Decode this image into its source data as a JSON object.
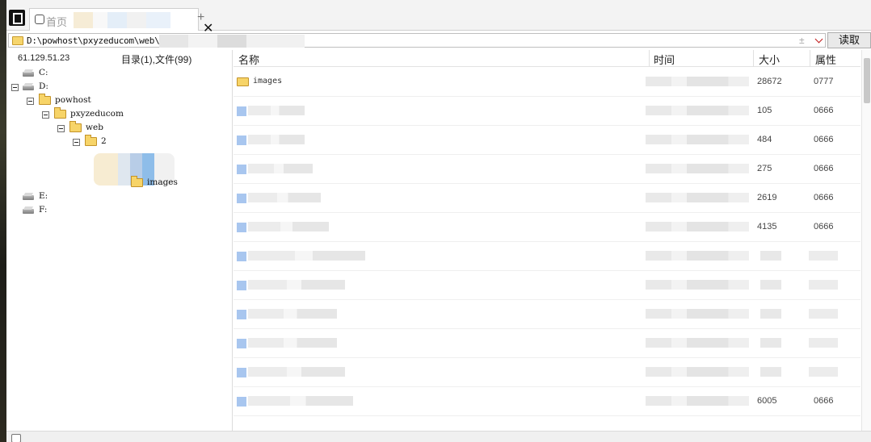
{
  "tabbar": {
    "tab_label": "首页",
    "close_glyph": "✕",
    "new_tab_glyph": "+"
  },
  "pathbar": {
    "path_text": "D:\\powhost\\pxyzeducom\\web\\2",
    "extra_glyph": "±",
    "read_button": "读取"
  },
  "leftpane": {
    "ip": "61.129.51.23",
    "dir_count": "目录(1),文件(99)",
    "tree": [
      {
        "label": "C:",
        "type": "drive",
        "expanded": false
      },
      {
        "label": "D:",
        "type": "drive",
        "expanded": true
      },
      {
        "label": "powhost",
        "type": "folder",
        "expanded": true
      },
      {
        "label": "pxyzeducom",
        "type": "folder",
        "expanded": true
      },
      {
        "label": "web",
        "type": "folder",
        "expanded": true
      },
      {
        "label": "2",
        "type": "folder",
        "expanded": true
      },
      {
        "label": "images",
        "type": "folder",
        "expanded": false
      },
      {
        "label": "E:",
        "type": "drive",
        "expanded": false
      },
      {
        "label": "F:",
        "type": "drive",
        "expanded": false
      }
    ]
  },
  "rightpane": {
    "columns": {
      "name": "名称",
      "time": "时间",
      "size": "大小",
      "attr": "属性"
    },
    "rows": [
      {
        "name": "images",
        "type": "folder",
        "size": "28672",
        "attr": "0777"
      },
      {
        "name": "",
        "type": "file",
        "size": "105",
        "attr": "0666"
      },
      {
        "name": "",
        "type": "file",
        "size": "484",
        "attr": "0666"
      },
      {
        "name": "",
        "type": "file",
        "size": "275",
        "attr": "0666"
      },
      {
        "name": "",
        "type": "file",
        "size": "2619",
        "attr": "0666"
      },
      {
        "name": "",
        "type": "file",
        "size": "4135",
        "attr": "0666"
      },
      {
        "name": "",
        "type": "file",
        "size": "",
        "attr": ""
      },
      {
        "name": "",
        "type": "file",
        "size": "",
        "attr": ""
      },
      {
        "name": "",
        "type": "file",
        "size": "",
        "attr": ""
      },
      {
        "name": "",
        "type": "file",
        "size": "",
        "attr": ""
      },
      {
        "name": "",
        "type": "file",
        "size": "",
        "attr": ""
      },
      {
        "name": "",
        "type": "file",
        "size": "6005",
        "attr": "0666"
      }
    ]
  },
  "colors": {
    "folder": "#f7d468",
    "file": "#a8c6ef",
    "accent_red": "#c01818"
  }
}
